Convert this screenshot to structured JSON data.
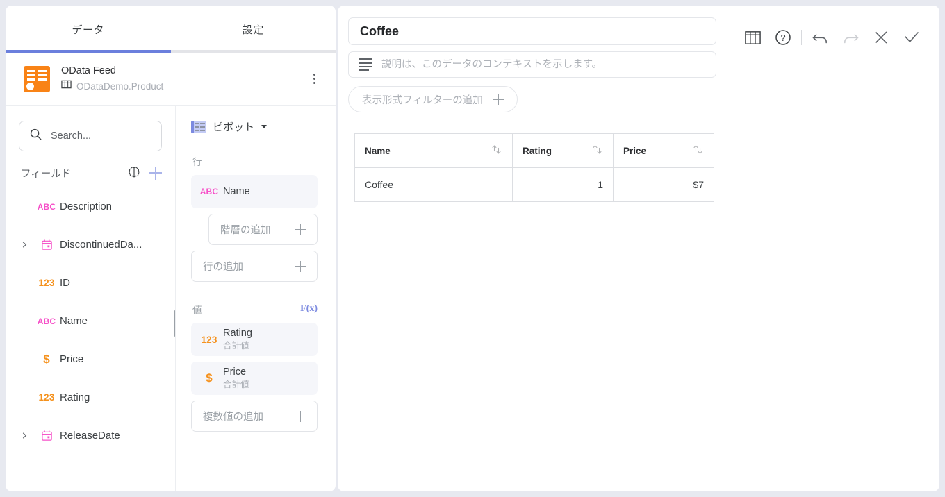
{
  "left_panel": {
    "tabs": [
      {
        "label": "データ",
        "active": true
      },
      {
        "label": "設定",
        "active": false
      }
    ],
    "active_indicator_color": "#6b7fdd",
    "data_source": {
      "icon": "odata-feed-icon",
      "title": "OData Feed",
      "entity_icon": "table-grid-icon",
      "entity": "ODataDemo.Product",
      "menu_icon": "kebab-menu-icon"
    },
    "search": {
      "icon": "search-icon",
      "value": "",
      "placeholder": "Search..."
    },
    "fields_header": {
      "label": "フィールド",
      "ai_icon": "brain-icon",
      "add_icon": "plus-icon"
    },
    "fields": [
      {
        "label": "Description",
        "type": "ABC",
        "type_icon": "text-type-icon",
        "expandable": false
      },
      {
        "label": "DiscontinuedDa...",
        "type": "DATE",
        "type_icon": "calendar-type-icon",
        "expandable": true
      },
      {
        "label": "ID",
        "type": "123",
        "type_icon": "number-type-icon",
        "expandable": false
      },
      {
        "label": "Name",
        "type": "ABC",
        "type_icon": "text-type-icon",
        "expandable": false
      },
      {
        "label": "Price",
        "type": "$",
        "type_icon": "currency-type-icon",
        "expandable": false
      },
      {
        "label": "Rating",
        "type": "123",
        "type_icon": "number-type-icon",
        "expandable": false
      },
      {
        "label": "ReleaseDate",
        "type": "DATE",
        "type_icon": "calendar-type-icon",
        "expandable": true
      }
    ],
    "type_colors": {
      "text": "#f650c8",
      "number": "#f5921e",
      "currency": "#f5921e",
      "date": "#f650c8"
    }
  },
  "pivot_panel": {
    "header": {
      "icon": "pivot-table-icon",
      "label": "ピボット",
      "caret_icon": "chevron-down-icon"
    },
    "rows_section": {
      "label": "行",
      "chips": [
        {
          "label": "Name",
          "type": "ABC",
          "type_icon": "text-type-icon"
        }
      ],
      "add_hierarchy": {
        "label": "階層の追加",
        "icon": "plus-icon"
      },
      "add_row": {
        "label": "行の追加",
        "icon": "plus-icon"
      }
    },
    "values_section": {
      "label": "値",
      "fx_label": "F(x)",
      "chips": [
        {
          "label": "Rating",
          "aggregation": "合計値",
          "type": "123",
          "type_icon": "number-type-icon"
        },
        {
          "label": "Price",
          "aggregation": "合計値",
          "type": "$",
          "type_icon": "currency-type-icon"
        }
      ],
      "add_value": {
        "label": "複数値の追加",
        "icon": "plus-icon"
      }
    }
  },
  "right_panel": {
    "title": {
      "value": "Coffee",
      "placeholder": ""
    },
    "description": {
      "icon": "description-lines-icon",
      "value": "",
      "placeholder": "説明は、このデータのコンテキストを示します。"
    },
    "filter_button": {
      "label": "表示形式フィルターの追加",
      "icon": "plus-icon"
    },
    "toolbar": [
      {
        "name": "table-view-icon",
        "enabled": true
      },
      {
        "name": "help-icon",
        "enabled": true
      },
      {
        "name": "undo-icon",
        "enabled": true
      },
      {
        "name": "redo-icon",
        "enabled": false
      },
      {
        "name": "close-icon",
        "enabled": true
      },
      {
        "name": "confirm-check-icon",
        "enabled": true
      }
    ]
  },
  "chart_data": {
    "type": "table",
    "title": "Coffee",
    "columns": [
      "Name",
      "Rating",
      "Price"
    ],
    "column_align": [
      "left",
      "right",
      "right"
    ],
    "sortable": [
      true,
      true,
      true
    ],
    "sort_icon": "sort-ascending-descending-icon",
    "rows": [
      [
        "Coffee",
        "1",
        "$7"
      ]
    ]
  }
}
